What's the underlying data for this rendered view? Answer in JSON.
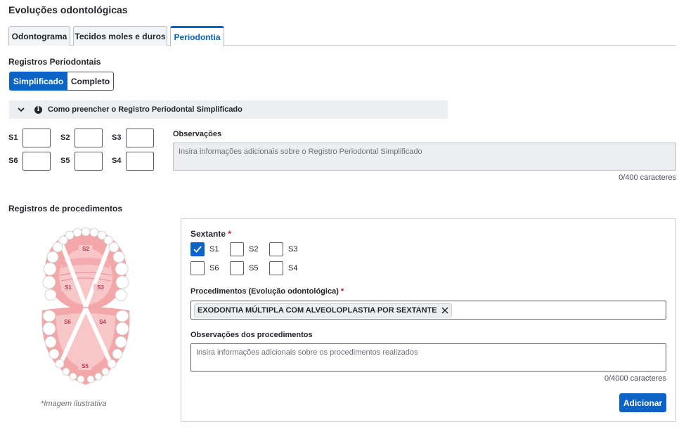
{
  "page": {
    "title": "Evoluções odontológicas"
  },
  "tabs": [
    {
      "label": "Odontograma",
      "active": false
    },
    {
      "label": "Tecidos moles e duros",
      "active": false
    },
    {
      "label": "Periodontia",
      "active": true
    }
  ],
  "periodontal": {
    "section_label": "Registros Periodontais",
    "mode_options": [
      "Simplificado",
      "Completo"
    ],
    "mode_selected": "Simplificado",
    "help_text": "Como preencher o Registro Periodontal Simplificado",
    "help_icons": {
      "toggle": "chevron-down-icon",
      "info": "info-icon"
    },
    "sextants": [
      {
        "label": "S1",
        "value": ""
      },
      {
        "label": "S2",
        "value": ""
      },
      {
        "label": "S3",
        "value": ""
      },
      {
        "label": "S6",
        "value": ""
      },
      {
        "label": "S5",
        "value": ""
      },
      {
        "label": "S4",
        "value": ""
      }
    ],
    "observations": {
      "label": "Observações",
      "placeholder": "Insira informações adicionais sobre o Registro Periodontal Simplificado",
      "value": "",
      "counter": "0/400 caracteres"
    }
  },
  "procedures": {
    "section_label": "Registros de procedimentos",
    "illustration": {
      "labels": [
        "S2",
        "S1",
        "S3",
        "S6",
        "S4",
        "S5"
      ],
      "caption": "*Imagem ilustrativa"
    },
    "sextant_field": {
      "label": "Sextante",
      "required_mark": "*",
      "options": [
        {
          "label": "S1",
          "checked": true
        },
        {
          "label": "S2",
          "checked": false
        },
        {
          "label": "S3",
          "checked": false
        },
        {
          "label": "S6",
          "checked": false
        },
        {
          "label": "S5",
          "checked": false
        },
        {
          "label": "S4",
          "checked": false
        }
      ]
    },
    "procedure_field": {
      "label": "Procedimentos (Evolução odontológica)",
      "required_mark": "*",
      "selected": [
        "EXODONTIA MÚLTIPLA COM ALVEOLOPLASTIA POR SEXTANTE"
      ]
    },
    "procedure_observations": {
      "label": "Observações dos procedimentos",
      "placeholder": "Insira informações adicionais sobre os procedimentos realizados",
      "value": "",
      "counter": "0/4000 caracteres"
    },
    "add_button": "Adicionar"
  },
  "colors": {
    "primary": "#0b64c5",
    "required": "#c0111f",
    "gum": "#f3a7a8",
    "sextant_label_bg": "#f7c8cb"
  }
}
